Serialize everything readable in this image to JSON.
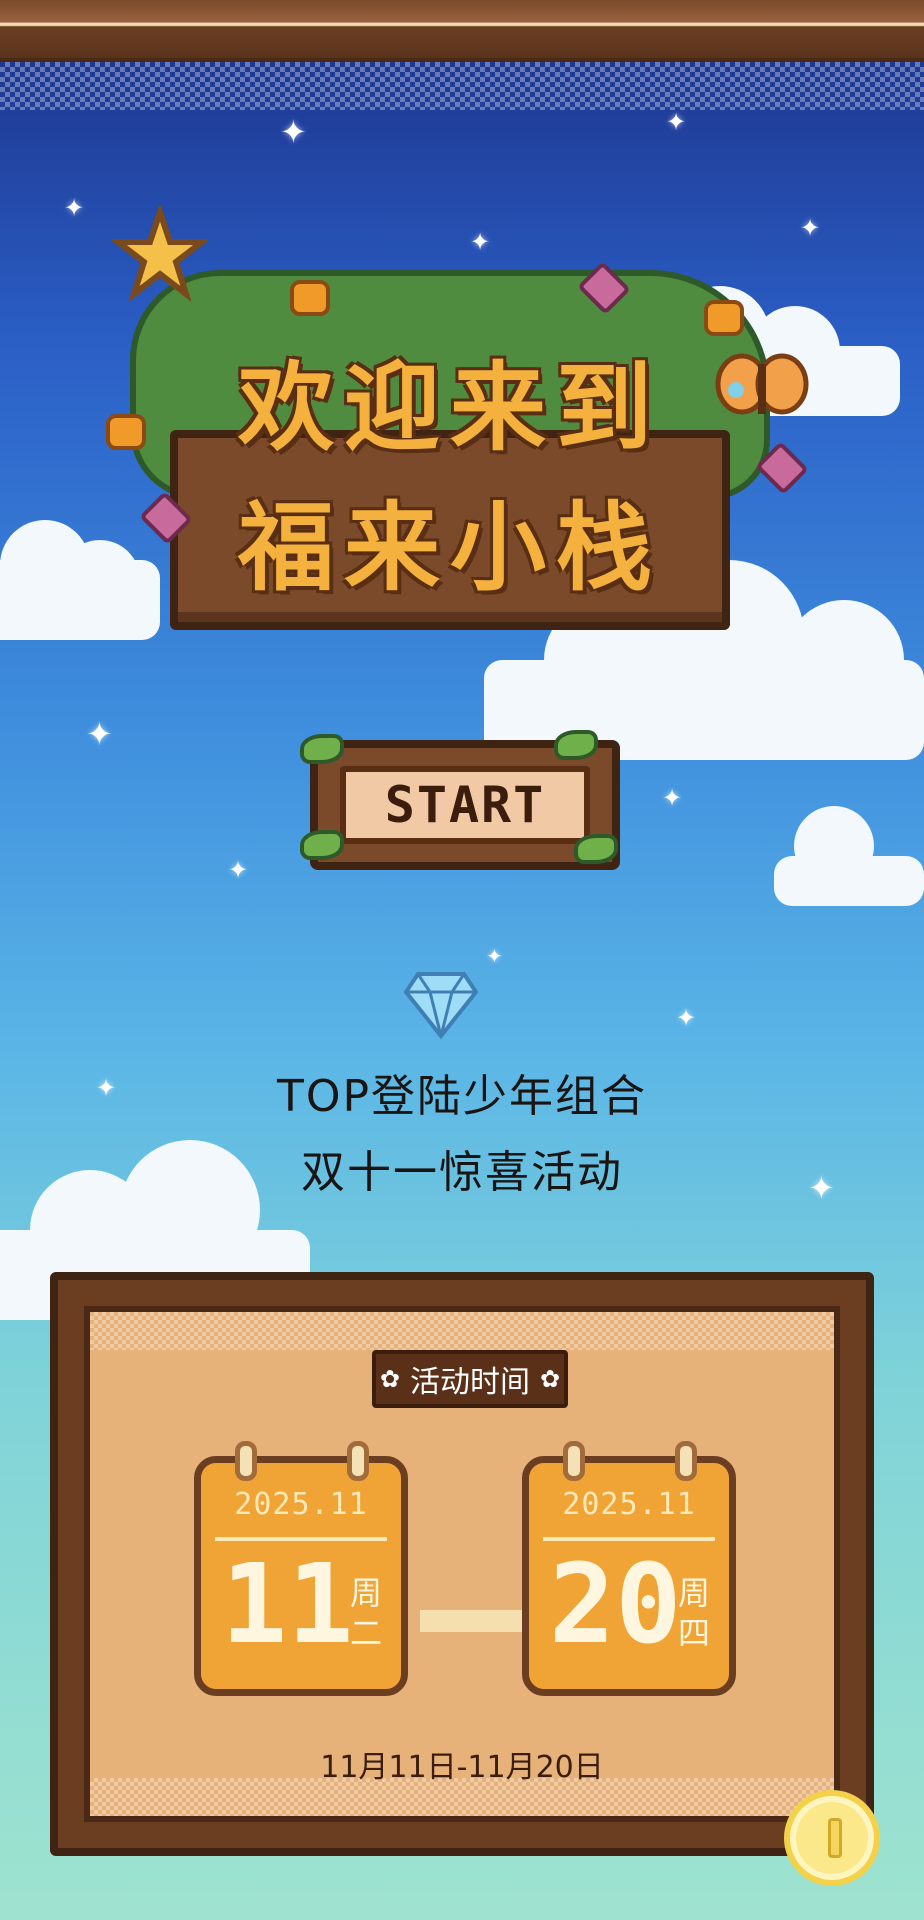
{
  "title": {
    "line1": "欢迎来到",
    "line2": "福来小栈"
  },
  "start_button": {
    "label": "START"
  },
  "event": {
    "line1": "TOP登陆少年组合",
    "line2": "双十一惊喜活动"
  },
  "activity_time": {
    "label": "活动时间",
    "start": {
      "year_month": "2025.11",
      "day": "11",
      "weekday_line1": "周",
      "weekday_line2": "二"
    },
    "end": {
      "year_month": "2025.11",
      "day": "20",
      "weekday_line1": "周",
      "weekday_line2": "四"
    },
    "range": "11月11日-11月20日"
  },
  "icons": {
    "sparkle": "star-sparkle-icon",
    "diamond": "diamond-icon",
    "coin": "coin-icon",
    "flower": "flower-icon"
  },
  "colors": {
    "title_fill": "#f4b13e",
    "board_brown": "#7b4a2b",
    "calendar_orange": "#f0a436",
    "panel_tan": "#e6b27a"
  }
}
